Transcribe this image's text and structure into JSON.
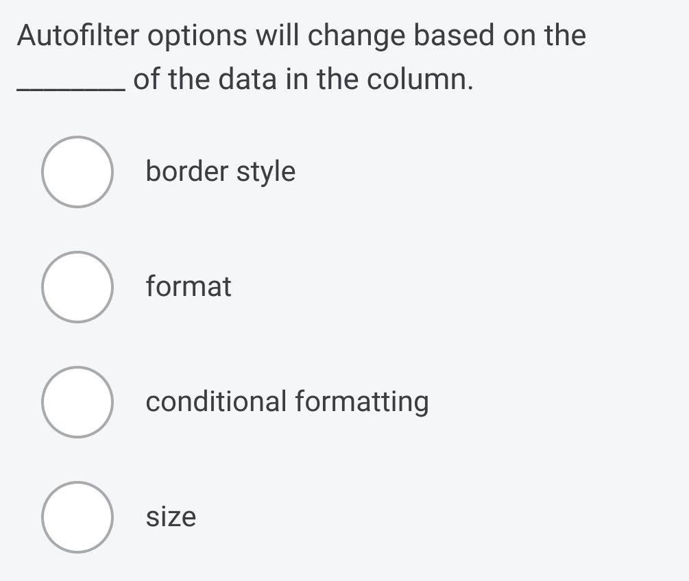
{
  "question": {
    "text": "Autofilter options will change based on the ________ of the data in the column."
  },
  "options": [
    {
      "label": "border style"
    },
    {
      "label": "format"
    },
    {
      "label": "conditional formatting"
    },
    {
      "label": "size"
    }
  ]
}
